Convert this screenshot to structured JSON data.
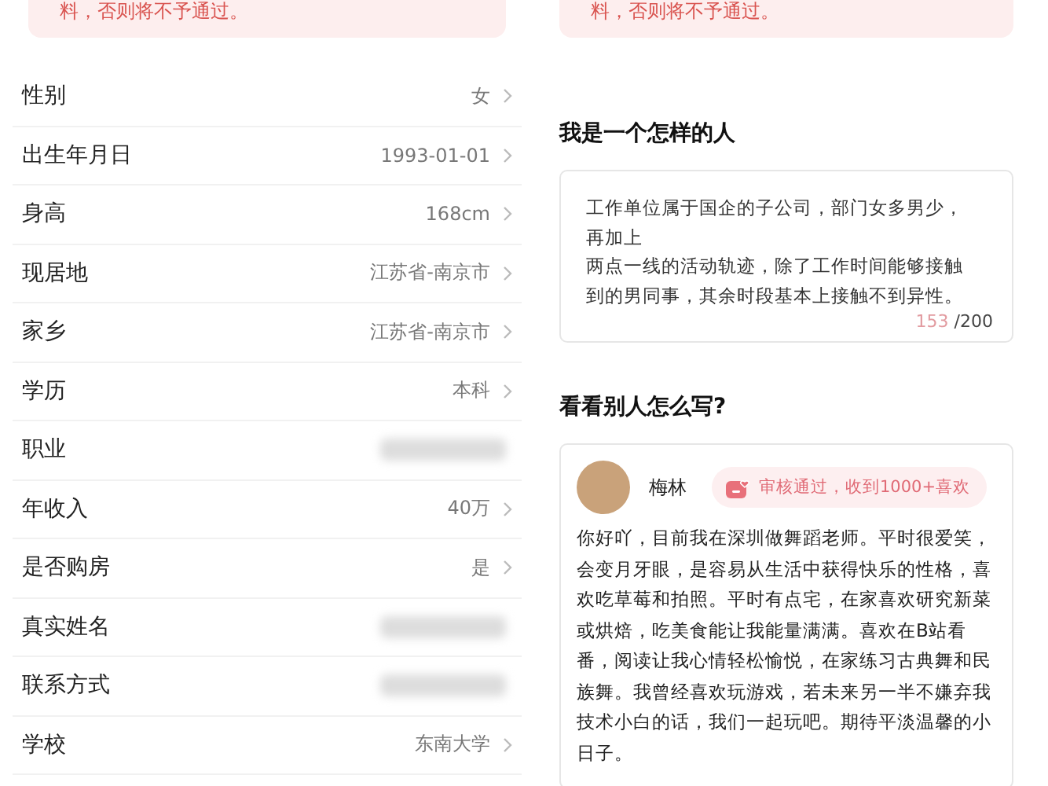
{
  "left_panel": {
    "notice": "料，否则将不予通过。",
    "fields": [
      {
        "label": "性别",
        "value": "女",
        "redacted": false
      },
      {
        "label": "出生年月日",
        "value": "1993-01-01",
        "redacted": false
      },
      {
        "label": "身高",
        "value": "168cm",
        "redacted": false
      },
      {
        "label": "现居地",
        "value": "江苏省-南京市",
        "redacted": false
      },
      {
        "label": "家乡",
        "value": "江苏省-南京市",
        "redacted": false
      },
      {
        "label": "学历",
        "value": "本科",
        "redacted": false
      },
      {
        "label": "职业",
        "redacted": true
      },
      {
        "label": "年收入",
        "value": "40万",
        "redacted": false
      },
      {
        "label": "是否购房",
        "value": "是",
        "redacted": false
      },
      {
        "label": "真实姓名",
        "redacted": true
      },
      {
        "label": "联系方式",
        "redacted": true
      },
      {
        "label": "学校",
        "value": "东南大学",
        "redacted": false
      }
    ]
  },
  "right_panel": {
    "notice": "料，否则将不予通过。",
    "self_intro": {
      "heading": "我是一个怎样的人",
      "lines": [
        "工作单位属于国企的子公司，部门女多男少，",
        "再加上",
        "两点一线的活动轨迹，除了工作时间能够接触",
        "到的男同事，其余时段基本上接触不到异性。"
      ],
      "count": "153",
      "limit": "/200"
    },
    "example": {
      "heading": "看看别人怎么写?",
      "name": "梅林",
      "badge": "审核通过，收到1000+喜欢",
      "text": "你好吖，目前我在深圳做舞蹈老师。平时很爱笑，会变月牙眼，是容易从生活中获得快乐的性格，喜欢吃草莓和拍照。平时有点宅，在家喜欢研究新菜或烘焙，吃美食能让我能量满满。喜欢在B站看番，阅读让我心情轻松愉悦，在家练习古典舞和民族舞。我曾经喜欢玩游戏，若未来另一半不嫌弃我技术小白的话，我们一起玩吧。期待平淡温馨的小日子。"
    }
  }
}
